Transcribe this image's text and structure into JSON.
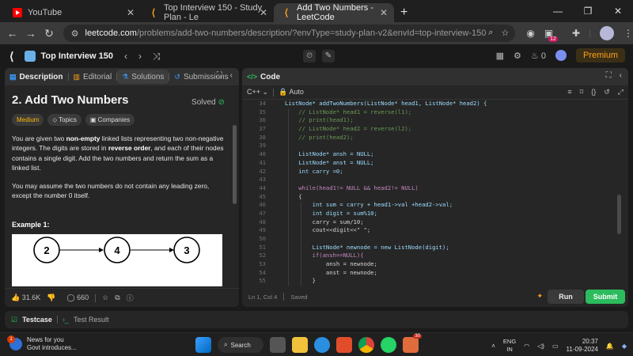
{
  "browser": {
    "tabs": [
      {
        "title": "YouTube"
      },
      {
        "title": "Top Interview 150 - Study Plan - Le"
      },
      {
        "title": "Add Two Numbers - LeetCode"
      }
    ],
    "address": {
      "host": "leetcode.com",
      "path": "/problems/add-two-numbers/description/?envType=study-plan-v2&envId=top-interview-150"
    },
    "extension_badge": "12"
  },
  "lc_header": {
    "study_plan_title": "Top Interview 150",
    "streak_count": "0",
    "premium_label": "Premium"
  },
  "description_panel": {
    "tabs": [
      "Description",
      "Editorial",
      "Solutions",
      "Submissions"
    ],
    "title": "2. Add Two Numbers",
    "solved_label": "Solved",
    "chips": [
      "Medium",
      "Topics",
      "Companies"
    ],
    "paragraph1": {
      "p1": "You are given two ",
      "b1": "non-empty",
      "p2": " linked lists representing two non-negative integers. The digits are stored in ",
      "b2": "reverse order",
      "p3": ", and each of their nodes contains a single digit. Add the two numbers and return the sum as a linked list."
    },
    "paragraph2": "You may assume the two numbers do not contain any leading zero, except the number 0 itself.",
    "example_title": "Example 1:",
    "example_nodes": [
      "2",
      "4",
      "3"
    ],
    "likes": "31.6K",
    "comments": "660"
  },
  "code_panel": {
    "title": "Code",
    "language": "C++",
    "mode": "Auto",
    "cursor_pos": "Ln 1, Col 4",
    "save_status": "Saved",
    "run_label": "Run",
    "submit_label": "Submit",
    "lines": [
      {
        "n": "34",
        "code": "ListNode* addTwoNumbers(ListNode* head1, ListNode* head2) {"
      },
      {
        "n": "35",
        "code": "    // ListNode* head1 = reverse(l1);"
      },
      {
        "n": "36",
        "code": "    // print(head1);"
      },
      {
        "n": "37",
        "code": "    // ListNode* head2 = reverse(l2);"
      },
      {
        "n": "38",
        "code": "    // print(head2);"
      },
      {
        "n": "39",
        "code": ""
      },
      {
        "n": "40",
        "code": "    ListNode* ansh = NULL;"
      },
      {
        "n": "41",
        "code": "    ListNode* anst = NULL;"
      },
      {
        "n": "42",
        "code": "    int carry =0;"
      },
      {
        "n": "43",
        "code": ""
      },
      {
        "n": "44",
        "code": "    while(head1!= NULL && head2!= NULL)"
      },
      {
        "n": "45",
        "code": "    {"
      },
      {
        "n": "46",
        "code": "        int sum = carry + head1->val +head2->val;"
      },
      {
        "n": "47",
        "code": "        int digit = sum%10;"
      },
      {
        "n": "48",
        "code": "        carry = sum/10;"
      },
      {
        "n": "49",
        "code": "        cout<<digit<<\" \";"
      },
      {
        "n": "50",
        "code": ""
      },
      {
        "n": "51",
        "code": "        ListNode* newnode = new ListNode(digit);"
      },
      {
        "n": "52",
        "code": "        if(ansh==NULL){"
      },
      {
        "n": "53",
        "code": "            ansh = newnode;"
      },
      {
        "n": "54",
        "code": "            anst = newnode;"
      },
      {
        "n": "55",
        "code": "        }"
      }
    ]
  },
  "bottom_panel": {
    "testcase_label": "Testcase",
    "result_label": "Test Result"
  },
  "taskbar": {
    "news_title": "News for you",
    "news_sub": "Govt introduces...",
    "news_badge": "1",
    "search_label": "Search",
    "app_badge": "30",
    "lang_top": "ENG",
    "lang_bottom": "IN",
    "time": "20:37",
    "date": "11-09-2024"
  }
}
